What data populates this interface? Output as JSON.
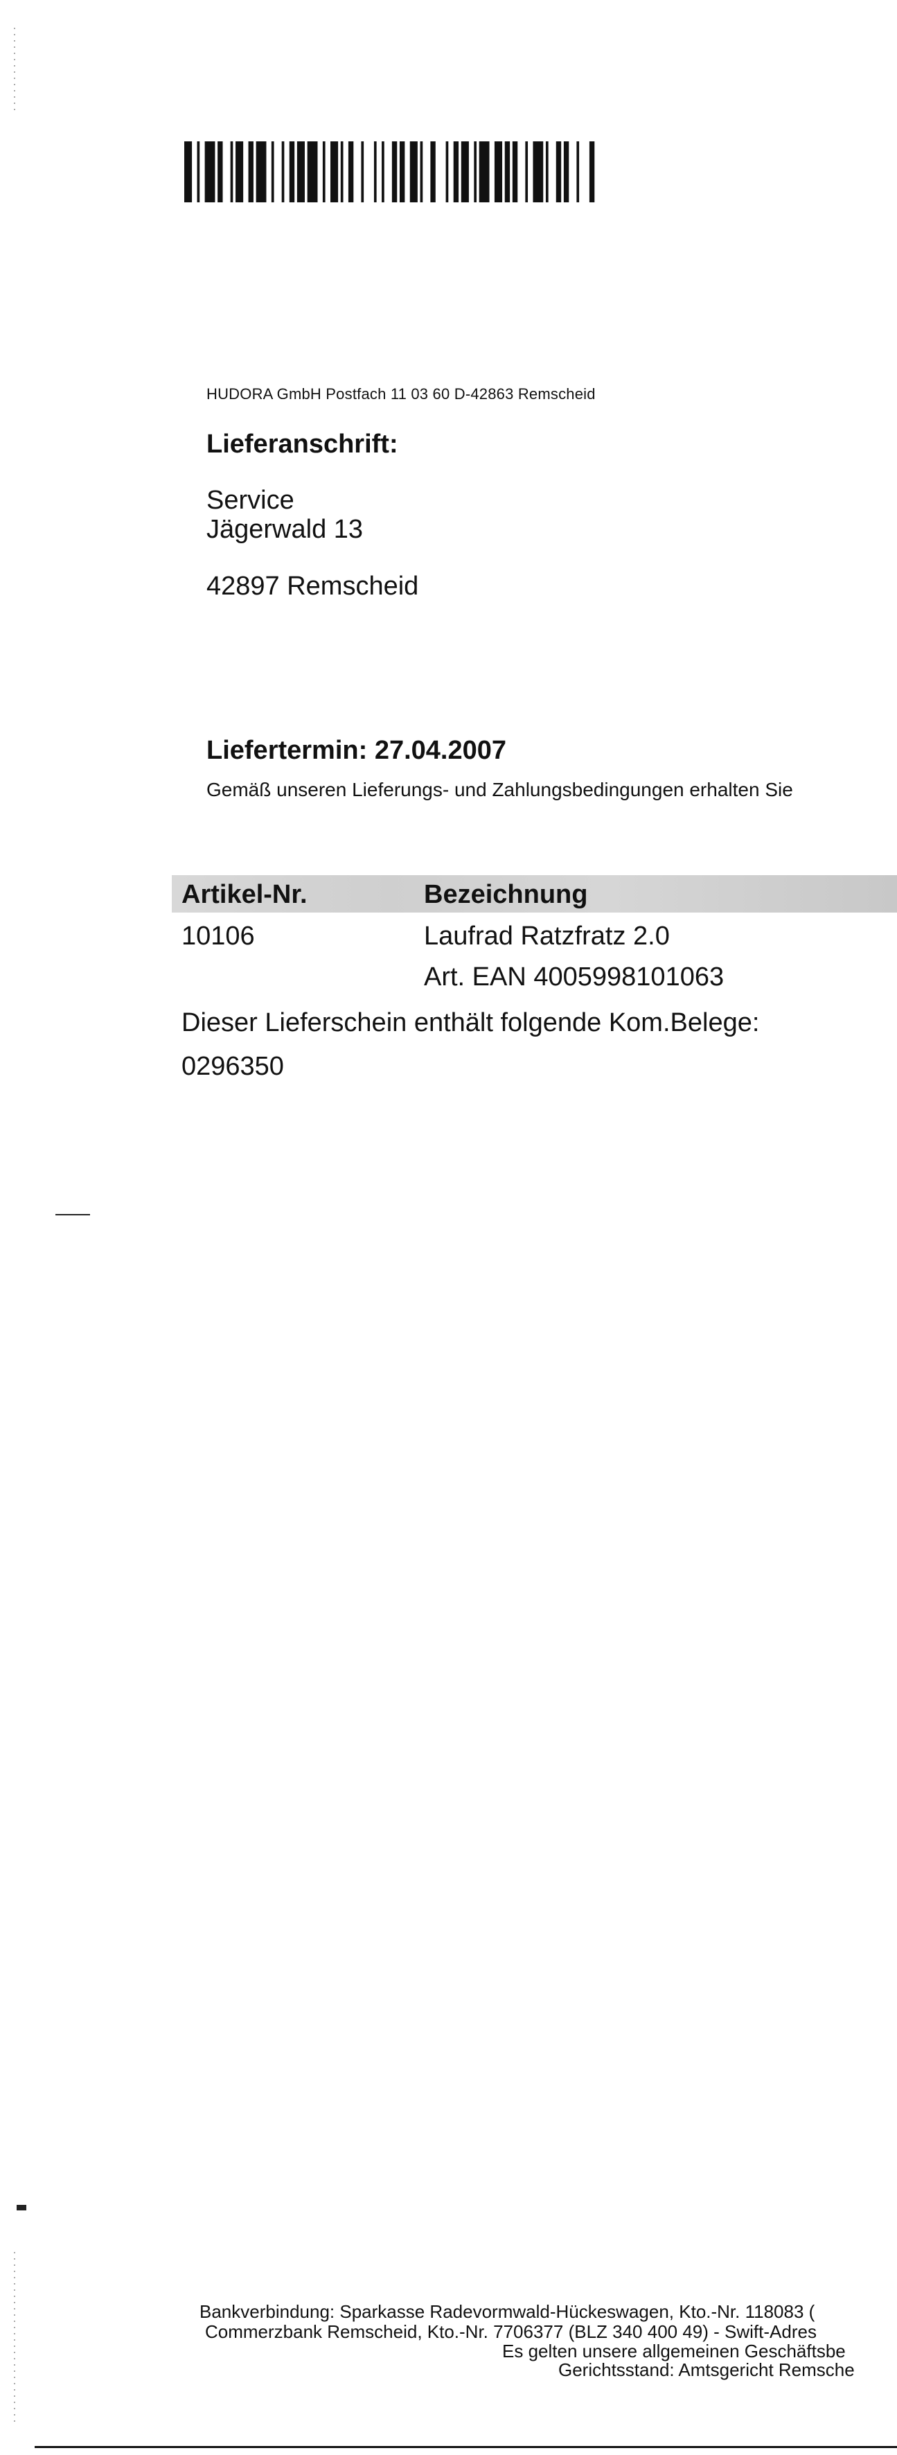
{
  "sender_line": "HUDORA GmbH Postfach 11 03 60 D-42863 Remscheid",
  "delivery_address": {
    "heading": "Lieferanschrift:",
    "line1": "Service",
    "line2": "Jägerwald 13",
    "city": "42897 Remscheid"
  },
  "delivery_date": {
    "text": "Liefertermin: 27.04.2007"
  },
  "terms_text": "Gemäß unseren Lieferungs- und Zahlungsbedingungen erhalten Sie",
  "table": {
    "headers": [
      "Artikel-Nr.",
      "Bezeichnung"
    ],
    "rows": [
      {
        "article_no": "10106",
        "description": "Laufrad Ratzfratz 2.0",
        "ean": "Art. EAN 4005998101063"
      }
    ]
  },
  "commission_note": "Dieser Lieferschein enthält folgende Kom.Belege:",
  "commission_number": "0296350",
  "footer": {
    "line1": "Bankverbindung: Sparkasse Radevormwald-Hückeswagen, Kto.-Nr. 118083 (",
    "line2": "Commerzbank Remscheid, Kto.-Nr. 7706377 (BLZ 340 400 49) - Swift-Adres",
    "line3": "Es gelten unsere allgemeinen Geschäftsbe",
    "line4": "Gerichtsstand: Amtsgericht Remsche"
  }
}
